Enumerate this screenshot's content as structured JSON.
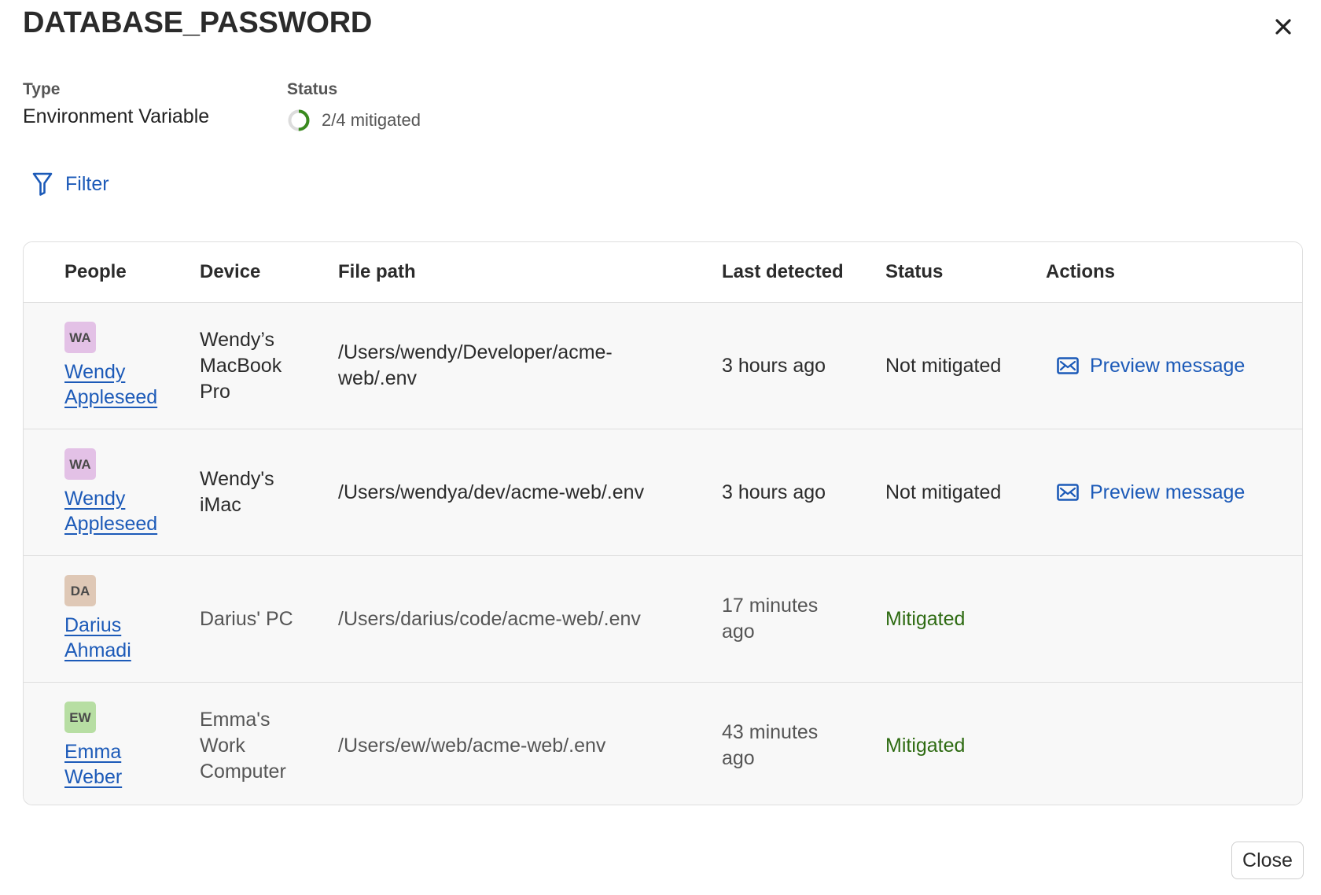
{
  "dialog": {
    "title": "DATABASE_PASSWORD",
    "close_icon": "close-icon",
    "type_label": "Type",
    "type_value": "Environment Variable",
    "status_label": "Status",
    "status_value": "2/4 mitigated",
    "status_progress": 0.5,
    "filter_label": "Filter",
    "close_button": "Close"
  },
  "table": {
    "headers": [
      "People",
      "Device",
      "File path",
      "Last detected",
      "Status",
      "Actions"
    ],
    "rows": [
      {
        "initials": "WA",
        "person": "Wendy Appleseed",
        "avatar_color": "#e3c1e6",
        "device": "Wendy’s MacBook Pro",
        "path": "/Users/wendy/Developer/acme-web/.env",
        "last_detected": "3 hours ago",
        "status": "Not mitigated",
        "action": "Preview message"
      },
      {
        "initials": "WA",
        "person": "Wendy Appleseed",
        "avatar_color": "#e3c1e6",
        "device": "Wendy's iMac",
        "path": "/Users/wendya/dev/acme-web/.env",
        "last_detected": "3 hours ago",
        "status": "Not mitigated",
        "action": "Preview message"
      },
      {
        "initials": "DA",
        "person": "Darius Ahmadi",
        "avatar_color": "#dfc8b6",
        "device": "Darius' PC",
        "path": "/Users/darius/code/acme-web/.env",
        "last_detected": "17 minutes ago",
        "status": "Mitigated",
        "action": ""
      },
      {
        "initials": "EW",
        "person": "Emma Weber",
        "avatar_color": "#b7dea3",
        "device": "Emma's Work Computer",
        "path": "/Users/ew/web/acme-web/.env",
        "last_detected": "43 minutes ago",
        "status": "Mitigated",
        "action": ""
      }
    ]
  },
  "colors": {
    "link": "#1c5ab8",
    "mitigated": "#2e6b12",
    "progress": "#3a8a1f",
    "row_background": "#f8f8f8"
  }
}
